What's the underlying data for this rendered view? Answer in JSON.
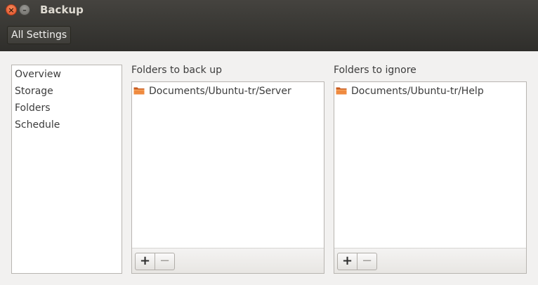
{
  "window": {
    "title": "Backup",
    "close_glyph": "×",
    "minimize_glyph": "–"
  },
  "toolbar": {
    "all_settings_label": "All Settings"
  },
  "sidebar": {
    "items": [
      {
        "label": "Overview"
      },
      {
        "label": "Storage"
      },
      {
        "label": "Folders"
      },
      {
        "label": "Schedule"
      }
    ]
  },
  "backup_panel": {
    "heading": "Folders to back up",
    "items": [
      {
        "label": "Documents/Ubuntu-tr/Server",
        "icon": "folder-icon"
      }
    ],
    "add_label": "+",
    "remove_label": "−"
  },
  "ignore_panel": {
    "heading": "Folders to ignore",
    "items": [
      {
        "label": "Documents/Ubuntu-tr/Help",
        "icon": "folder-icon"
      }
    ],
    "add_label": "+",
    "remove_label": "−"
  },
  "colors": {
    "titlebar": "#3c3b37",
    "close_button": "#e0502a",
    "folder": "#d96c2e"
  }
}
